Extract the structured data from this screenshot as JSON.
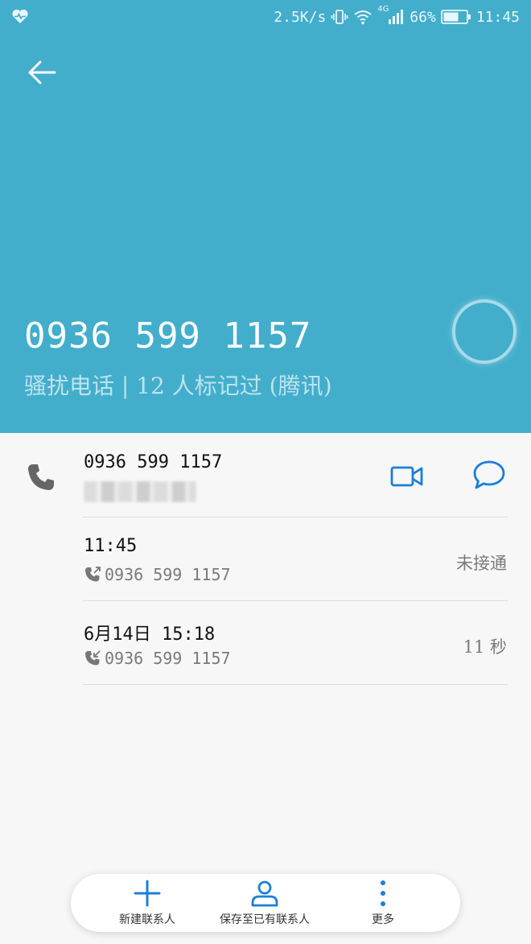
{
  "status_bar": {
    "net_speed": "2.5K/s",
    "network_type": "4G",
    "battery_percent": "66%",
    "time": "11:45",
    "icons": [
      "health-icon",
      "vibrate-icon",
      "wifi-icon",
      "signal-icon",
      "battery-icon"
    ]
  },
  "header": {
    "number": "0936 599 1157",
    "tag_text": "骚扰电话 | 12 人标记过 (腾讯)",
    "background_color": "#42aecc"
  },
  "contact": {
    "number": "0936 599 1157",
    "actions": [
      "video-call-icon",
      "message-icon"
    ],
    "accent_color": "#1a7fd8"
  },
  "call_log": [
    {
      "time": "11:45",
      "direction": "outgoing",
      "number": "0936 599 1157",
      "status": "未接通"
    },
    {
      "time": "6月14日 15:18",
      "direction": "incoming",
      "number": "0936 599 1157",
      "status": "11 秒"
    }
  ],
  "bottom_bar": {
    "new_contact": "新建联系人",
    "save_to_existing": "保存至已有联系人",
    "more": "更多"
  }
}
